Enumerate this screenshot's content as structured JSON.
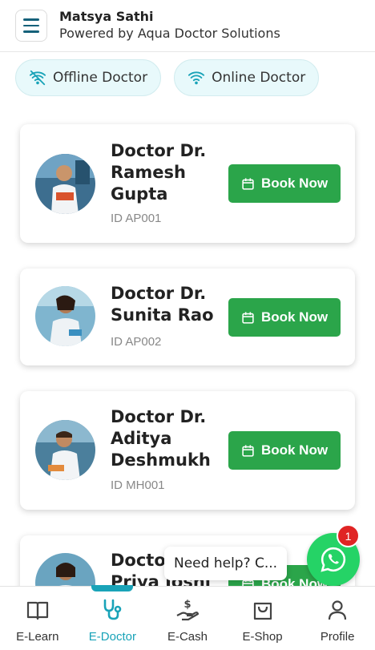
{
  "header": {
    "title": "Matsya Sathi",
    "subtitle": "Powered by Aqua Doctor Solutions"
  },
  "filters": [
    {
      "label": "Offline Doctor",
      "icon": "wifi-off-icon"
    },
    {
      "label": "Online Doctor",
      "icon": "wifi-icon"
    }
  ],
  "doctors": [
    {
      "name": "Doctor Dr. Ramesh Gupta",
      "id": "ID AP001",
      "button": "Book Now"
    },
    {
      "name": "Doctor Dr. Sunita Rao",
      "id": "ID AP002",
      "button": "Book Now"
    },
    {
      "name": "Doctor Dr. Aditya Deshmukh",
      "id": "ID MH001",
      "button": "Book Now"
    },
    {
      "name": "Doctor Dr. Priya Joshi",
      "id": "",
      "button": "Book Now"
    }
  ],
  "help": {
    "text": "Need help? C...",
    "badge": "1"
  },
  "nav": [
    {
      "label": "E-Learn",
      "icon": "book-icon",
      "active": false
    },
    {
      "label": "E-Doctor",
      "icon": "stethoscope-icon",
      "active": true
    },
    {
      "label": "E-Cash",
      "icon": "cash-hand-icon",
      "active": false
    },
    {
      "label": "E-Shop",
      "icon": "shopping-bag-icon",
      "active": false
    },
    {
      "label": "Profile",
      "icon": "user-icon",
      "active": false
    }
  ],
  "colors": {
    "accent": "#19a3b8",
    "book_button": "#2ba54a",
    "whatsapp": "#25d366",
    "badge": "#e02424"
  }
}
